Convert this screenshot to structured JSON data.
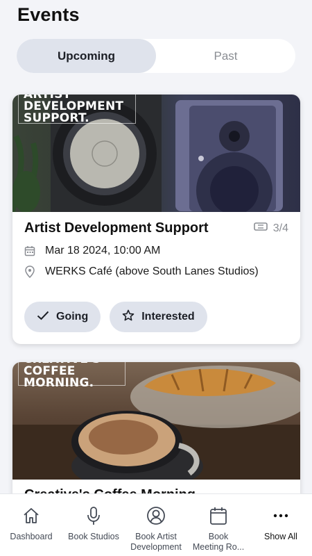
{
  "page": {
    "title": "Events"
  },
  "segments": {
    "upcoming": "Upcoming",
    "past": "Past",
    "selected": "Upcoming"
  },
  "events": [
    {
      "overlay_text": "ARTIST\nDEVELOPMENT\nSUPPORT.",
      "title": "Artist Development Support",
      "tickets": "3/4",
      "datetime": "Mar 18 2024, 10:00 AM",
      "location": "WERKS Café (above South Lanes Studios)",
      "actions": {
        "going": "Going",
        "interested": "Interested"
      }
    },
    {
      "overlay_text": "CREATIVE'S\nCOFFEE\nMORNING.",
      "title": "Creative's Coffee Morning"
    }
  ],
  "tabbar": [
    {
      "label": "Dashboard",
      "icon": "home-icon"
    },
    {
      "label": "Book Studios",
      "icon": "microphone-icon"
    },
    {
      "label": "Book Artist\nDevelopment",
      "icon": "person-circle-icon"
    },
    {
      "label": "Book\nMeeting Ro...",
      "icon": "calendar-icon"
    },
    {
      "label": "Show All",
      "icon": "more-icon"
    }
  ],
  "colors": {
    "pill": "#dfe3ec",
    "background": "#f3f4f8",
    "muted": "#8a8d93"
  }
}
